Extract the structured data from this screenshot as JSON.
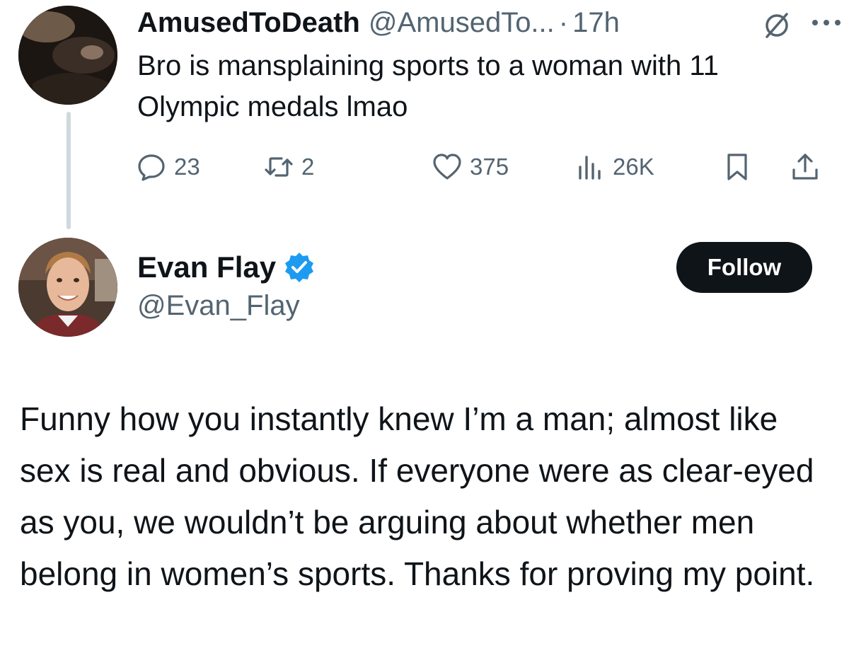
{
  "reply": {
    "display_name": "AmusedToDeath",
    "handle": "@AmusedTo...",
    "dot": "·",
    "time": "17h",
    "text": "Bro is mansplaining sports to a woman with 11 Olympic medals lmao",
    "stats": {
      "replies": "23",
      "retweets": "2",
      "likes": "375",
      "views": "26K"
    },
    "icons": [
      "grok-icon",
      "more-icon",
      "reply-icon",
      "retweet-icon",
      "like-icon",
      "views-icon",
      "bookmark-icon",
      "share-icon"
    ]
  },
  "main": {
    "display_name": "Evan Flay",
    "handle": "@Evan_Flay",
    "follow_label": "Follow",
    "verified_icon": "verified-badge-icon",
    "text": "Funny how you instantly knew I’m a man; almost like sex is real and obvious. If everyone were as clear-eyed as you, we wouldn’t be arguing about whether men belong in women’s sports. Thanks for proving my point."
  },
  "colors": {
    "text": "#0f1419",
    "secondary": "#536471",
    "verified": "#1d9bf0",
    "thread_line": "#cfd9de",
    "button": "#0f1419"
  }
}
